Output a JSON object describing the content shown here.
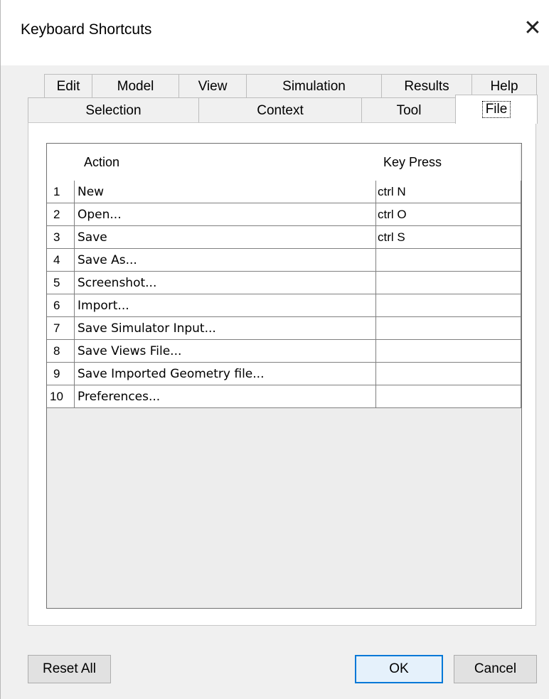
{
  "window": {
    "title": "Keyboard Shortcuts",
    "close_glyph": "✕"
  },
  "tabs_back": [
    {
      "label": "Edit"
    },
    {
      "label": "Model"
    },
    {
      "label": "View"
    },
    {
      "label": "Simulation"
    },
    {
      "label": "Results"
    },
    {
      "label": "Help"
    }
  ],
  "tabs_front": [
    {
      "label": "Selection"
    },
    {
      "label": "Context"
    },
    {
      "label": "Tool"
    },
    {
      "label": "File"
    }
  ],
  "active_tab": "File",
  "table": {
    "columns": [
      "Action",
      "Key Press"
    ],
    "rows": [
      {
        "num": "1",
        "action": "New",
        "key": "ctrl N"
      },
      {
        "num": "2",
        "action": "Open...",
        "key": "ctrl O"
      },
      {
        "num": "3",
        "action": "Save",
        "key": "ctrl S"
      },
      {
        "num": "4",
        "action": "Save As...",
        "key": ""
      },
      {
        "num": "5",
        "action": "Screenshot...",
        "key": ""
      },
      {
        "num": "6",
        "action": "Import...",
        "key": ""
      },
      {
        "num": "7",
        "action": "Save Simulator Input...",
        "key": ""
      },
      {
        "num": "8",
        "action": "Save Views File...",
        "key": ""
      },
      {
        "num": "9",
        "action": "Save Imported Geometry file...",
        "key": ""
      },
      {
        "num": "10",
        "action": "Preferences...",
        "key": ""
      }
    ]
  },
  "buttons": {
    "reset": "Reset All",
    "ok": "OK",
    "cancel": "Cancel"
  },
  "colors": {
    "accent": "#0078d7",
    "dialog_bg": "#f0f0f0",
    "grid_line": "#808080"
  }
}
